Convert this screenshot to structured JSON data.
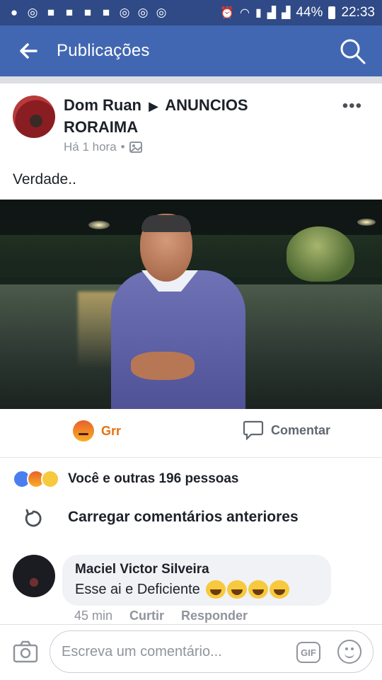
{
  "status_bar": {
    "battery": "44%",
    "time": "22:33",
    "icons": [
      "chat-icon",
      "eye-icon",
      "facebook-icon",
      "facebook-icon",
      "facebook-icon",
      "facebook-icon",
      "eye-icon",
      "eye-icon",
      "eye-icon",
      "alarm-icon",
      "wifi-icon",
      "sim-icon",
      "signal-icon",
      "signal-icon",
      "battery-icon"
    ]
  },
  "appbar": {
    "title": "Publicações"
  },
  "post": {
    "author": "Dom Ruan",
    "target": "ANUNCIOS RORAIMA",
    "time": "Há 1 hora",
    "text": "Verdade..",
    "actions": {
      "reaction_label": "Grr",
      "comment_label": "Comentar"
    },
    "reactions_summary": "Você e outras 196 pessoas"
  },
  "comments": {
    "load_more": "Carregar comentários anteriores",
    "items": [
      {
        "name": "Maciel Victor Silveira",
        "text": "Esse ai e Deficiente",
        "time": "45 min",
        "like": "Curtir",
        "reply": "Responder"
      }
    ]
  },
  "composer": {
    "placeholder": "Escreva um comentário...",
    "gif_label": "GIF"
  },
  "colors": {
    "status_bar": "#2f4a86",
    "app_bar": "#4267b2",
    "grr": "#e9710f"
  }
}
